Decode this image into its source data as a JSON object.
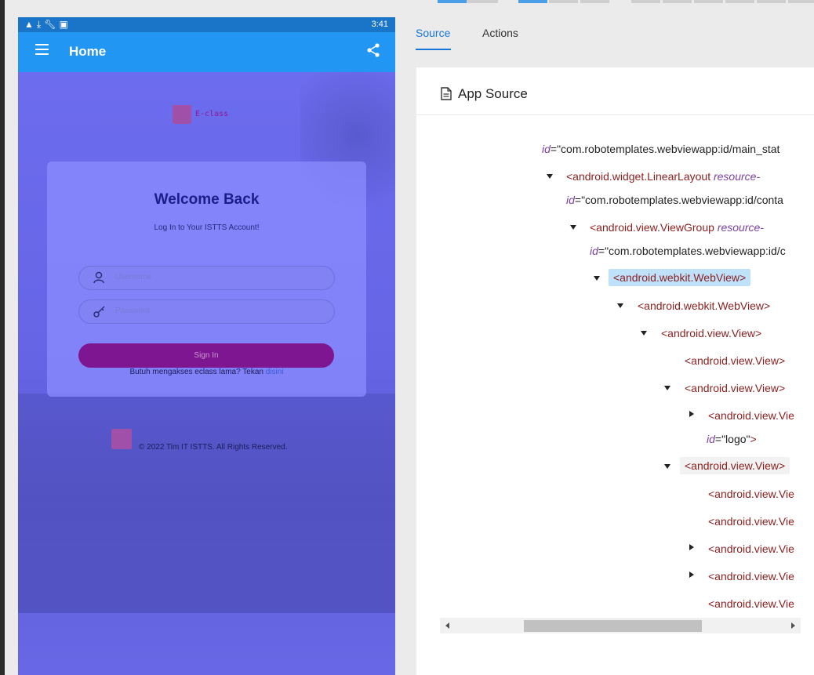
{
  "device": {
    "status_time": "3:41",
    "status_icons": [
      "alert-icon",
      "download-icon",
      "wrench-icon",
      "sim-icon"
    ],
    "appbar_title": "Home",
    "login": {
      "brand": "E-class",
      "welcome": "Welcome Back",
      "subtitle": "Log In to Your ISTTS Account!",
      "username_placeholder": "Username",
      "password_placeholder": "Password",
      "sign_in": "Sign In",
      "legacy_text": "Butuh mengakses eclass lama? Tekan",
      "legacy_link": "disini",
      "footer": "© 2022 Tim IT ISTTS. All Rights Reserved."
    }
  },
  "inspector": {
    "tabs": [
      "Source",
      "Actions"
    ],
    "active_tab": "Source",
    "panel_title": "App Source",
    "tree": [
      {
        "attr": "id",
        "value": "=\"com.robotemplates.webviewapp:id/main_stat"
      },
      {
        "tag": "<android.widget.LinearLayout",
        "attr": "resource-"
      },
      {
        "attr": "id",
        "value": "=\"com.robotemplates.webviewapp:id/conta"
      },
      {
        "tag": "<android.view.ViewGroup",
        "attr": "resource-"
      },
      {
        "attr": "id",
        "value": "=\"com.robotemplates.webviewapp:id/c"
      },
      {
        "tag": "<android.webkit.WebView>"
      },
      {
        "tag": "<android.webkit.WebView>"
      },
      {
        "tag": "<android.view.View>"
      },
      {
        "tag": "<android.view.View>"
      },
      {
        "tag": "<android.view.View>"
      },
      {
        "tag": "<android.view.Vie"
      },
      {
        "attr": "id",
        "value": "=\"logo\"",
        "close": ">"
      },
      {
        "tag": "<android.view.View>"
      },
      {
        "tag": "<android.view.Vie"
      },
      {
        "tag": "<android.view.Vie"
      },
      {
        "tag": "<android.view.Vie"
      },
      {
        "tag": "<android.view.Vie"
      },
      {
        "tag": "<android.view.Vie"
      }
    ]
  },
  "colors": {
    "accent": "#1677d8",
    "appbar": "#2196f3",
    "statusbar": "#1a75c9",
    "sign_in_button": "#7e1691",
    "selected_node": "#bfe1fa"
  }
}
